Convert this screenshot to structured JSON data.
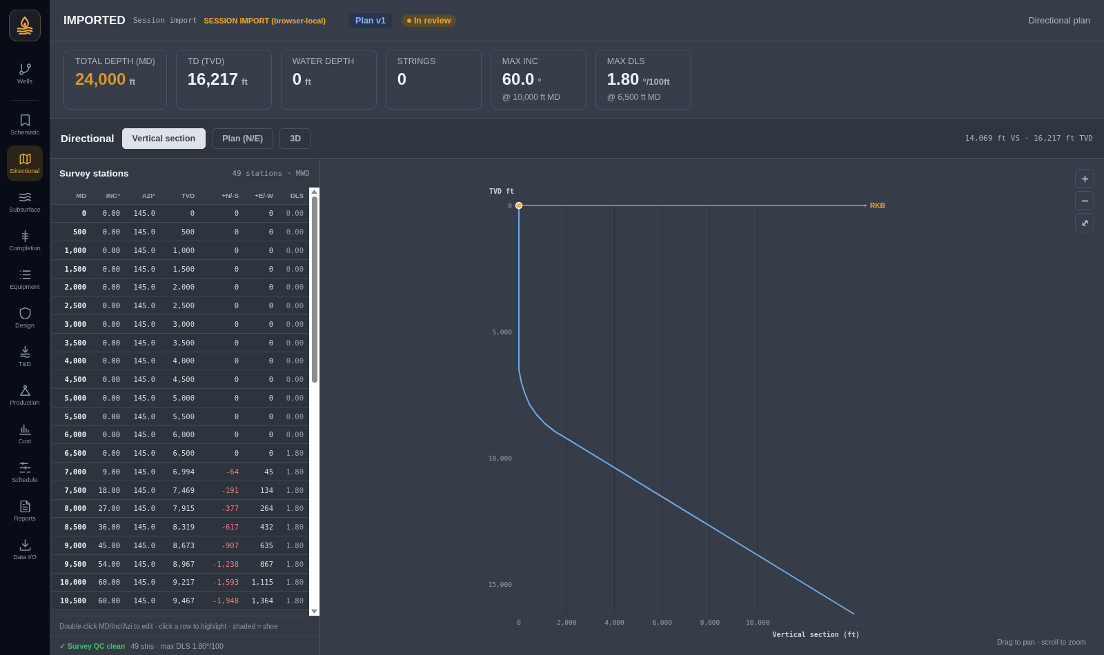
{
  "sidebar": {
    "groups": [
      [
        {
          "label": "Wells",
          "selected": false
        }
      ],
      [
        {
          "label": "Schematic",
          "selected": false
        },
        {
          "label": "Directional",
          "selected": true
        },
        {
          "label": "Subsurface",
          "selected": false
        },
        {
          "label": "Completion",
          "selected": false
        },
        {
          "label": "Equipment",
          "selected": false
        },
        {
          "label": "Design",
          "selected": false
        },
        {
          "label": "T&D",
          "selected": false
        },
        {
          "label": "Production",
          "selected": false
        },
        {
          "label": "Cost",
          "selected": false
        },
        {
          "label": "Schedule",
          "selected": false
        },
        {
          "label": "Reports",
          "selected": false
        },
        {
          "label": "Data I/O",
          "selected": false
        }
      ]
    ]
  },
  "header": {
    "title": "IMPORTED",
    "subtitle": "Session import",
    "source": "SESSION IMPORT (browser-local)",
    "badges": [
      {
        "kind": "plan",
        "label": "Plan v1"
      },
      {
        "kind": "status",
        "label": "In review"
      }
    ],
    "context": "Directional plan"
  },
  "metrics": [
    {
      "label": "TOTAL DEPTH (MD)",
      "value": "24,000",
      "unit": "ft",
      "accent": true
    },
    {
      "label": "TD (TVD)",
      "value": "16,217",
      "unit": "ft",
      "accent": false
    },
    {
      "label": "WATER DEPTH",
      "value": "0",
      "unit": "ft",
      "accent": false
    },
    {
      "label": "STRINGS",
      "value": "0",
      "accent": false
    },
    {
      "label": "MAX INC",
      "value": "60.0",
      "unit": "°",
      "note": "@ 10,000 ft MD",
      "accent": false
    },
    {
      "label": "MAX DLS",
      "value": "1.80",
      "unit": "°/100ft",
      "note": "@ 6,500 ft MD",
      "accent": false
    }
  ],
  "directional": {
    "title": "Directional",
    "tabs": [
      {
        "label": "Vertical section",
        "selected": true
      },
      {
        "label": "Plan (N/E)",
        "selected": false
      },
      {
        "label": "3D",
        "selected": false
      }
    ],
    "summary": "14,069 ft VS · 16,217 ft TVD"
  },
  "survey": {
    "title": "Survey stations",
    "count": "49 stations · MWD",
    "table": {
      "columns": [
        "MD",
        "INC°",
        "AZI°",
        "TVD",
        "+N/-S",
        "+E/-W",
        "DLS"
      ],
      "rows": [
        {
          "md": "0",
          "inc": "0.00",
          "azi": "145.0",
          "tvd": "0",
          "ns": "0",
          "ew": "0",
          "dls": "0.00",
          "ns_negative": false
        },
        {
          "md": "500",
          "inc": "0.00",
          "azi": "145.0",
          "tvd": "500",
          "ns": "0",
          "ew": "0",
          "dls": "0.00",
          "ns_negative": false
        },
        {
          "md": "1,000",
          "inc": "0.00",
          "azi": "145.0",
          "tvd": "1,000",
          "ns": "0",
          "ew": "0",
          "dls": "0.00",
          "ns_negative": false
        },
        {
          "md": "1,500",
          "inc": "0.00",
          "azi": "145.0",
          "tvd": "1,500",
          "ns": "0",
          "ew": "0",
          "dls": "0.00",
          "ns_negative": false
        },
        {
          "md": "2,000",
          "inc": "0.00",
          "azi": "145.0",
          "tvd": "2,000",
          "ns": "0",
          "ew": "0",
          "dls": "0.00",
          "ns_negative": false
        },
        {
          "md": "2,500",
          "inc": "0.00",
          "azi": "145.0",
          "tvd": "2,500",
          "ns": "0",
          "ew": "0",
          "dls": "0.00",
          "ns_negative": false
        },
        {
          "md": "3,000",
          "inc": "0.00",
          "azi": "145.0",
          "tvd": "3,000",
          "ns": "0",
          "ew": "0",
          "dls": "0.00",
          "ns_negative": false
        },
        {
          "md": "3,500",
          "inc": "0.00",
          "azi": "145.0",
          "tvd": "3,500",
          "ns": "0",
          "ew": "0",
          "dls": "0.00",
          "ns_negative": false
        },
        {
          "md": "4,000",
          "inc": "0.00",
          "azi": "145.0",
          "tvd": "4,000",
          "ns": "0",
          "ew": "0",
          "dls": "0.00",
          "ns_negative": false
        },
        {
          "md": "4,500",
          "inc": "0.00",
          "azi": "145.0",
          "tvd": "4,500",
          "ns": "0",
          "ew": "0",
          "dls": "0.00",
          "ns_negative": false
        },
        {
          "md": "5,000",
          "inc": "0.00",
          "azi": "145.0",
          "tvd": "5,000",
          "ns": "0",
          "ew": "0",
          "dls": "0.00",
          "ns_negative": false
        },
        {
          "md": "5,500",
          "inc": "0.00",
          "azi": "145.0",
          "tvd": "5,500",
          "ns": "0",
          "ew": "0",
          "dls": "0.00",
          "ns_negative": false
        },
        {
          "md": "6,000",
          "inc": "0.00",
          "azi": "145.0",
          "tvd": "6,000",
          "ns": "0",
          "ew": "0",
          "dls": "0.00",
          "ns_negative": false
        },
        {
          "md": "6,500",
          "inc": "0.00",
          "azi": "145.0",
          "tvd": "6,500",
          "ns": "0",
          "ew": "0",
          "dls": "1.80",
          "ns_negative": false
        },
        {
          "md": "7,000",
          "inc": "9.00",
          "azi": "145.0",
          "tvd": "6,994",
          "ns": "-64",
          "ew": "45",
          "dls": "1.80",
          "ns_negative": true
        },
        {
          "md": "7,500",
          "inc": "18.00",
          "azi": "145.0",
          "tvd": "7,469",
          "ns": "-191",
          "ew": "134",
          "dls": "1.80",
          "ns_negative": true
        },
        {
          "md": "8,000",
          "inc": "27.00",
          "azi": "145.0",
          "tvd": "7,915",
          "ns": "-377",
          "ew": "264",
          "dls": "1.80",
          "ns_negative": true
        },
        {
          "md": "8,500",
          "inc": "36.00",
          "azi": "145.0",
          "tvd": "8,319",
          "ns": "-617",
          "ew": "432",
          "dls": "1.80",
          "ns_negative": true
        },
        {
          "md": "9,000",
          "inc": "45.00",
          "azi": "145.0",
          "tvd": "8,673",
          "ns": "-907",
          "ew": "635",
          "dls": "1.80",
          "ns_negative": true
        },
        {
          "md": "9,500",
          "inc": "54.00",
          "azi": "145.0",
          "tvd": "8,967",
          "ns": "-1,238",
          "ew": "867",
          "dls": "1.80",
          "ns_negative": true
        },
        {
          "md": "10,000",
          "inc": "60.00",
          "azi": "145.0",
          "tvd": "9,217",
          "ns": "-1,593",
          "ew": "1,115",
          "dls": "1.80",
          "ns_negative": true
        },
        {
          "md": "10,500",
          "inc": "60.00",
          "azi": "145.0",
          "tvd": "9,467",
          "ns": "-1,948",
          "ew": "1,364",
          "dls": "1.80",
          "ns_negative": true
        }
      ]
    },
    "hint": "Double-click MD/Inc/Azi to edit · click a row to highlight · shaded ≈ shoe",
    "qc": {
      "ok": true,
      "status": "✓ Survey QC clean",
      "detail": "49 stns · max DLS 1.80°/100"
    }
  },
  "chart_panel": {
    "chart_data": {
      "type": "line",
      "xlabel": "Vertical section (ft)",
      "ylabel": "TVD ft",
      "x": [
        0,
        0,
        100,
        250,
        450,
        750,
        1100,
        1500,
        1950,
        14050
      ],
      "values": [
        0,
        6500,
        7000,
        7450,
        7900,
        8300,
        8650,
        8950,
        9200,
        16200
      ],
      "xlim": [
        0,
        14500
      ],
      "ylim": [
        16200,
        0
      ],
      "xticks": [
        {
          "value": 0,
          "label": "0"
        },
        {
          "value": 2000,
          "label": "2,000"
        },
        {
          "value": 4000,
          "label": "4,000"
        },
        {
          "value": 6000,
          "label": "6,000"
        },
        {
          "value": 8000,
          "label": "8,000"
        },
        {
          "value": 10000,
          "label": "10,000"
        }
      ],
      "yticks": [
        {
          "value": 0,
          "label": "0"
        },
        {
          "value": 5000,
          "label": "5,000"
        },
        {
          "value": 10000,
          "label": "10,000"
        },
        {
          "value": 15000,
          "label": "15,000"
        }
      ],
      "grid": true,
      "ref_lines": [
        {
          "axis": "y",
          "value": 0,
          "label": "RKB"
        }
      ]
    },
    "hint": "Drag to pan · scroll to zoom"
  }
}
